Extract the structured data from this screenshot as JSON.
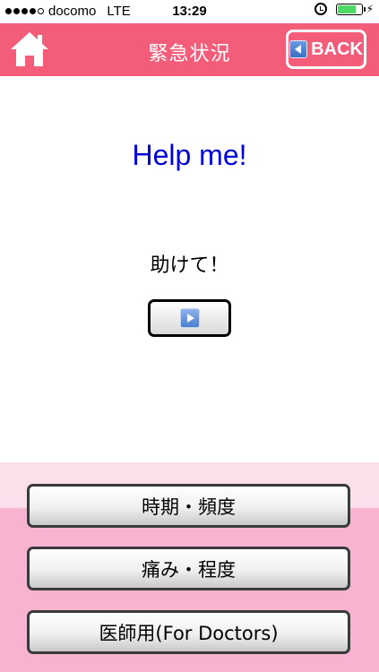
{
  "status_bar": {
    "carrier": "docomo",
    "network": "LTE",
    "time": "13:29",
    "signal_bars_filled": 4,
    "signal_bars_total": 5,
    "battery_level": 0.8,
    "battery_color": "#4cd964"
  },
  "nav": {
    "title": "緊急状況",
    "back_label": "BACK",
    "home_icon": "home-icon",
    "bar_color": "#f35d7a"
  },
  "phrase": {
    "english": "Help me!",
    "japanese": "助けて！",
    "english_color": "#0000d8"
  },
  "categories": [
    {
      "label": "時期・頻度"
    },
    {
      "label": "痛み・程度"
    },
    {
      "label": "医師用(For Doctors)"
    }
  ]
}
